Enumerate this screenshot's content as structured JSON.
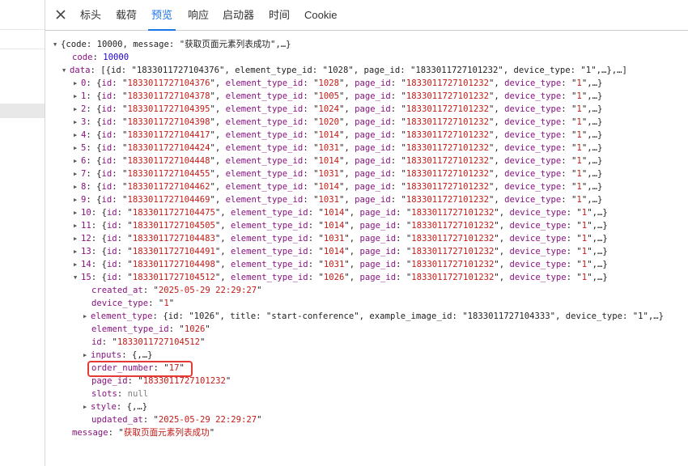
{
  "tabs": [
    {
      "label": "标头",
      "active": false
    },
    {
      "label": "载荷",
      "active": false
    },
    {
      "label": "预览",
      "active": true
    },
    {
      "label": "响应",
      "active": false
    },
    {
      "label": "启动器",
      "active": false
    },
    {
      "label": "时间",
      "active": false
    },
    {
      "label": "Cookie",
      "active": false
    }
  ],
  "tree": {
    "root_summary": "{code: 10000, message: \"获取页面元素列表成功\",…}",
    "code": {
      "key": "code",
      "value": "10000"
    },
    "data": {
      "key": "data",
      "summary": "[{id: \"1833011727104376\", element_type_id: \"1028\", page_id: \"1833011727101232\", device_type: \"1\",…},…]"
    },
    "items": [
      {
        "index": "0",
        "id": "1833011727104376",
        "element_type_id": "1028",
        "page_id": "1833011727101232",
        "device_type": "1"
      },
      {
        "index": "1",
        "id": "1833011727104378",
        "element_type_id": "1005",
        "page_id": "1833011727101232",
        "device_type": "1"
      },
      {
        "index": "2",
        "id": "1833011727104395",
        "element_type_id": "1024",
        "page_id": "1833011727101232",
        "device_type": "1"
      },
      {
        "index": "3",
        "id": "1833011727104398",
        "element_type_id": "1020",
        "page_id": "1833011727101232",
        "device_type": "1"
      },
      {
        "index": "4",
        "id": "1833011727104417",
        "element_type_id": "1014",
        "page_id": "1833011727101232",
        "device_type": "1"
      },
      {
        "index": "5",
        "id": "1833011727104424",
        "element_type_id": "1031",
        "page_id": "1833011727101232",
        "device_type": "1"
      },
      {
        "index": "6",
        "id": "1833011727104448",
        "element_type_id": "1014",
        "page_id": "1833011727101232",
        "device_type": "1"
      },
      {
        "index": "7",
        "id": "1833011727104455",
        "element_type_id": "1031",
        "page_id": "1833011727101232",
        "device_type": "1"
      },
      {
        "index": "8",
        "id": "1833011727104462",
        "element_type_id": "1014",
        "page_id": "1833011727101232",
        "device_type": "1"
      },
      {
        "index": "9",
        "id": "1833011727104469",
        "element_type_id": "1031",
        "page_id": "1833011727101232",
        "device_type": "1"
      },
      {
        "index": "10",
        "id": "1833011727104475",
        "element_type_id": "1014",
        "page_id": "1833011727101232",
        "device_type": "1"
      },
      {
        "index": "11",
        "id": "1833011727104505",
        "element_type_id": "1014",
        "page_id": "1833011727101232",
        "device_type": "1"
      },
      {
        "index": "12",
        "id": "1833011727104483",
        "element_type_id": "1031",
        "page_id": "1833011727101232",
        "device_type": "1"
      },
      {
        "index": "13",
        "id": "1833011727104491",
        "element_type_id": "1014",
        "page_id": "1833011727101232",
        "device_type": "1"
      },
      {
        "index": "14",
        "id": "1833011727104498",
        "element_type_id": "1031",
        "page_id": "1833011727101232",
        "device_type": "1"
      },
      {
        "index": "15",
        "id": "1833011727104512",
        "element_type_id": "1026",
        "page_id": "1833011727101232",
        "device_type": "1"
      }
    ],
    "expanded": {
      "created_at": "2025-05-29 22:29:27",
      "device_type": "1",
      "element_type_summary": "{id: \"1026\", title: \"start-conference\", example_image_id: \"1833011727104333\", device_type: \"1\",…}",
      "element_type_id": "1026",
      "id": "1833011727104512",
      "inputs_summary": "{,…}",
      "order_number": "17",
      "page_id": "1833011727101232",
      "slots": "null",
      "style_summary": "{,…}",
      "updated_at": "2025-05-29 22:29:27"
    },
    "message": {
      "key": "message",
      "value": "获取页面元素列表成功"
    }
  },
  "colors": {
    "key": "#881280",
    "string": "#c41a16",
    "number": "#1c00cf",
    "active_tab": "#1a73e8",
    "highlight": "#e53935"
  },
  "icons": {
    "close": "close-icon",
    "expand": "expand-triangle-icon",
    "collapse": "collapse-triangle-icon"
  }
}
